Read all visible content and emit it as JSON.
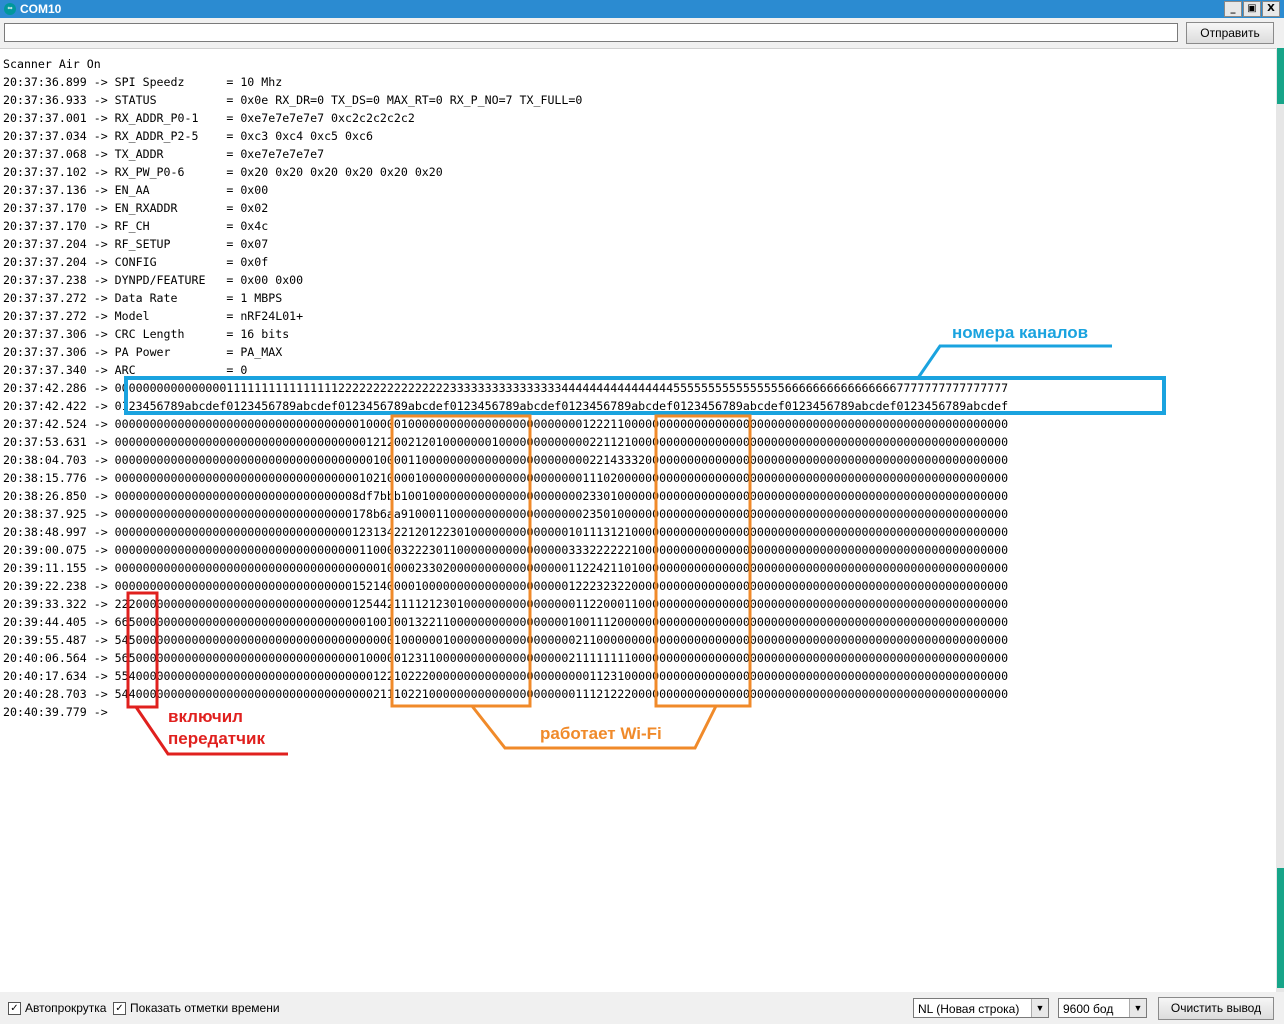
{
  "window": {
    "title": "COM10",
    "icon": "arduino-icon",
    "controls": [
      "_",
      "▣",
      "X"
    ]
  },
  "send": {
    "input_value": "",
    "button_label": "Отправить"
  },
  "output_lines": [
    "Scanner Air On",
    "20:37:36.899 -> SPI Speedz      = 10 Mhz",
    "20:37:36.933 -> STATUS          = 0x0e RX_DR=0 TX_DS=0 MAX_RT=0 RX_P_NO=7 TX_FULL=0",
    "20:37:37.001 -> RX_ADDR_P0-1    = 0xe7e7e7e7e7 0xc2c2c2c2c2",
    "20:37:37.034 -> RX_ADDR_P2-5    = 0xc3 0xc4 0xc5 0xc6",
    "20:37:37.068 -> TX_ADDR         = 0xe7e7e7e7e7",
    "20:37:37.102 -> RX_PW_P0-6      = 0x20 0x20 0x20 0x20 0x20 0x20",
    "20:37:37.136 -> EN_AA           = 0x00",
    "20:37:37.170 -> EN_RXADDR       = 0x02",
    "20:37:37.170 -> RF_CH           = 0x4c",
    "20:37:37.204 -> RF_SETUP        = 0x07",
    "20:37:37.204 -> CONFIG          = 0x0f",
    "20:37:37.238 -> DYNPD/FEATURE   = 0x00 0x00",
    "20:37:37.272 -> Data Rate       = 1 MBPS",
    "20:37:37.272 -> Model           = nRF24L01+",
    "20:37:37.306 -> CRC Length      = 16 bits",
    "20:37:37.306 -> PA Power        = PA_MAX",
    "20:37:37.340 -> ARC             = 0",
    "20:37:42.286 -> 00000000000000001111111111111111222222222222222233333333333333334444444444444444555555555555555566666666666666667777777777777777",
    "20:37:42.422 -> 0123456789abcdef0123456789abcdef0123456789abcdef0123456789abcdef0123456789abcdef0123456789abcdef0123456789abcdef0123456789abcdef",
    "20:37:42.524 -> 00000000000000000000000000000000000100000100000000000000000000000001222110000000000000000000000000000000000000000000000000000000",
    "20:37:53.631 -> 00000000000000000000000000000000000012120021201000000010000000000000221121000000000000000000000000000000000000000000000000000000",
    "20:38:04.703 -> 00000000000000000000000000000000000001000011000000000000000000000000221433320000000000000000000000000000000000000000000000000000",
    "20:38:15.776 -> 00000000000000000000000000000000000102100001000000000000000000000001110200000000000000000000000000000000000000000000000000000000",
    "20:38:26.850 -> 00000000000000000000000000000000008df7bbb100100000000000000000000002330100000000000000000000000000000000000000000000000000000000",
    "20:38:37.925 -> 0000000000000000000000000000000000178b6aa910001100000000000000000002350100000000000000000000000000000000000000000000000000000000",
    "20:38:48.997 -> 00000000000000000000000000000000001231342212012230100000000000000101113121000000000000000000000000000000000000000000000000000000",
    "20:39:00.075 -> 00000000000000000000000000000000000110000322230110000000000000000333222222100000000000000000000000000000000000000000000000000000",
    "20:39:11.155 -> 00000000000000000000000000000000000000100002330200000000000000000112242110100000000000000000000000000000000000000000000000000000",
    "20:39:22.238 -> 00000000000000000000000000000000001521400001000000000000000000000122232322000000000000000000000000000000000000000000000000000000",
    "20:39:33.322 -> 22200000000000000000000000000000001254421111212301000000000000000011220001100000000000000000000000000000000000000000000000000000",
    "20:39:44.405 -> 66500000000000000000000000000000000010010013221100000000000000000100111200000000000000000000000000000000000000000000000000000000",
    "20:39:55.487 -> 54500000000000000000000000000000000000001000000100000000000000000021100000000000000000000000000000000000000000000000000000000000",
    "20:40:06.564 -> 56500000000000000000000000000000000100000123110000000000000000000211111111000000000000000000000000000000000000000000000000000000",
    "20:40:17.634 -> 55400000000000000000000000000000000001221022200000000000000000000000112310000000000000000000000000000000000000000000000000000000",
    "20:40:28.703 -> 54400000000000000000000000000000000002111022100000000000000000000011121222000000000000000000000000000000000000000000000000000000",
    "20:40:39.779 -> "
  ],
  "annotations": {
    "channels": "номера каналов",
    "transmitter_line1": "включил",
    "transmitter_line2": "передатчик",
    "wifi": "работает Wi-Fi"
  },
  "annotation_colors": {
    "blue": "#1aa3df",
    "red": "#e0201e",
    "orange": "#f08a2a"
  },
  "bottom": {
    "autoscroll_label": "Автопрокрутка",
    "autoscroll_checked": true,
    "timestamps_label": "Показать отметки времени",
    "timestamps_checked": true,
    "line_ending": "NL (Новая строка)",
    "baud_rate": "9600 бод",
    "clear_button": "Очистить вывод"
  }
}
